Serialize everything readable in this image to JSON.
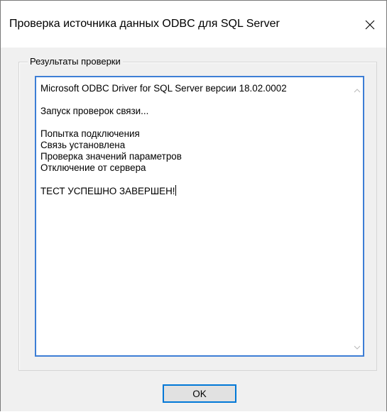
{
  "window": {
    "title": "Проверка источника данных ODBC для SQL Server",
    "close_icon": "close-icon"
  },
  "results": {
    "group_label": "Результаты проверки",
    "lines": [
      "Microsoft ODBC Driver for SQL Server версии 18.02.0002",
      "",
      "Запуск проверок связи...",
      "",
      "Попытка подключения",
      "Связь установлена",
      "Проверка значений параметров",
      "Отключение от сервера",
      "",
      "ТЕСТ УСПЕШНО ЗАВЕРШЕН!"
    ],
    "scroll_up_icon": "chevron-up-icon",
    "scroll_down_icon": "chevron-down-icon"
  },
  "buttons": {
    "ok_label": "OK"
  },
  "colors": {
    "focus_border": "#3d7ed5",
    "button_border": "#0078d7",
    "button_face": "#e1e1e1",
    "dialog_bg": "#f0f0f0"
  }
}
